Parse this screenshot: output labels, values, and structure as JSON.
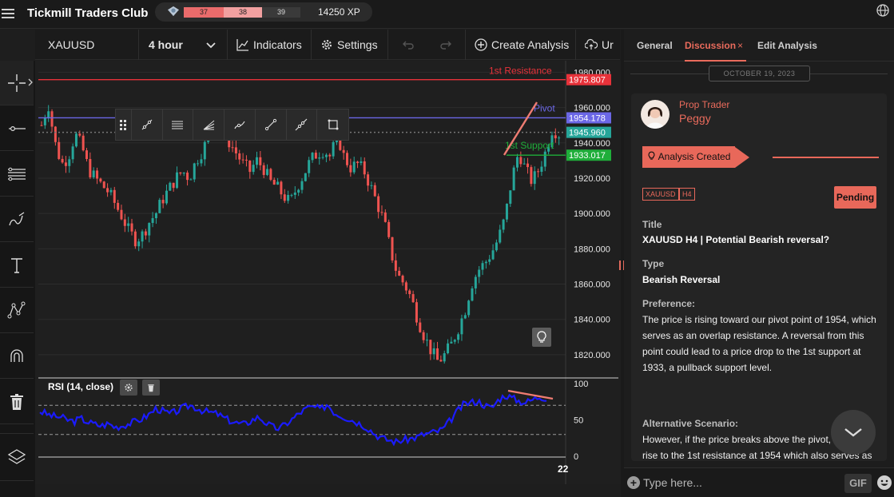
{
  "app": {
    "title": "Tickmill Traders Club",
    "xp": {
      "segments": [
        "37",
        "38",
        "39"
      ],
      "total": "14250 XP"
    }
  },
  "chart_toolbar": {
    "symbol": "XAUUSD",
    "interval": "4 hour",
    "indicators_label": "Indicators",
    "settings_label": "Settings",
    "create_label": "Create Analysis",
    "upload_label": "Ur"
  },
  "left_tools": [
    "crosshair-icon",
    "horizontal-line-icon",
    "fib-lines-icon",
    "brush-icon",
    "text-icon",
    "pattern-icon",
    "magnet-icon",
    "trash-icon",
    "layers-icon"
  ],
  "floating_tools": [
    "drag-handle-icon",
    "ray-icon",
    "parallel-channel-icon",
    "fib-fan-icon",
    "pitchfork-icon",
    "trend-line-icon",
    "extended-line-icon",
    "rectangle-icon"
  ],
  "chart_data": {
    "type": "candlestick",
    "symbol": "XAUUSD",
    "interval": "4 hour",
    "y_axis": {
      "ticks": [
        "1980.000",
        "1960.000",
        "1940.000",
        "1920.000",
        "1900.000",
        "1880.000",
        "1860.000",
        "1840.000",
        "1820.000"
      ],
      "ylim": [
        1810,
        1982
      ]
    },
    "x_axis": {
      "ticks": [
        "22"
      ]
    },
    "close_path": [
      1950,
      1962,
      1940,
      1928,
      1932,
      1945,
      1938,
      1925,
      1920,
      1916,
      1912,
      1905,
      1898,
      1890,
      1885,
      1888,
      1895,
      1900,
      1908,
      1914,
      1920,
      1924,
      1920,
      1930,
      1936,
      1945,
      1950,
      1946,
      1940,
      1934,
      1928,
      1924,
      1930,
      1926,
      1918,
      1915,
      1910,
      1906,
      1915,
      1922,
      1930,
      1934,
      1936,
      1932,
      1945,
      1932,
      1926,
      1928,
      1924,
      1915,
      1905,
      1895,
      1878,
      1865,
      1860,
      1852,
      1840,
      1830,
      1822,
      1816,
      1820,
      1826,
      1835,
      1845,
      1860,
      1868,
      1872,
      1878,
      1886,
      1898,
      1920,
      1935,
      1925,
      1918,
      1925,
      1935,
      1948,
      1945
    ],
    "levels": [
      {
        "name": "1st Resistance",
        "value": "1975.807",
        "color": "#e8323a"
      },
      {
        "name": "Pivot",
        "value": "1954.178",
        "color": "#6b67e6"
      },
      {
        "name": "",
        "value": "1945.960",
        "color": "#26a69a"
      },
      {
        "name": "1st Support",
        "value": "1933.017",
        "color": "#1fae3a"
      }
    ],
    "rsi": {
      "label": "RSI (14, close)",
      "ticks": [
        "100",
        "50",
        "0"
      ],
      "path": [
        62,
        58,
        55,
        54,
        50,
        48,
        52,
        47,
        44,
        42,
        45,
        40,
        42,
        45,
        48,
        52,
        58,
        66,
        62,
        58,
        62,
        67,
        70,
        66,
        62,
        60,
        58,
        52,
        48,
        45,
        44,
        50,
        54,
        46,
        40,
        38,
        45,
        52,
        60,
        66,
        68,
        64,
        72,
        60,
        56,
        52,
        48,
        44,
        38,
        30,
        25,
        22,
        20,
        22,
        24,
        26,
        30,
        32,
        34,
        38,
        50,
        62,
        72,
        74,
        76,
        70,
        66,
        78,
        84,
        80,
        76,
        74,
        78,
        82,
        80
      ]
    }
  },
  "panel": {
    "tabs": [
      "General",
      "Discussion",
      "Edit Analysis"
    ],
    "tab_close": "×",
    "date": "OCTOBER 19, 2023",
    "author_line1": "Prop Trader",
    "author_line2": "Peggy",
    "status": "Analysis Created",
    "tags": [
      "XAUUSD",
      "H4"
    ],
    "pending": "Pending",
    "title_label": "Title",
    "title_value": "XAUUSD H4 | Potential Bearish reversal?",
    "type_label": "Type",
    "type_value": "Bearish Reversal",
    "preference_label": "Preference:",
    "preference_text": "The price is rising toward our pivot point of 1954, which serves as an overlap resistance. A reversal from this point could lead to a price drop to the 1st support at 1933, a pullback support level.",
    "alt_label": "Alternative Scenario:",
    "alt_text": "However, if the price breaks above the pivot, it might rise to the 1st resistance at 1954 which also serves as",
    "composer_placeholder": "Type here...",
    "gif_label": "GIF"
  }
}
